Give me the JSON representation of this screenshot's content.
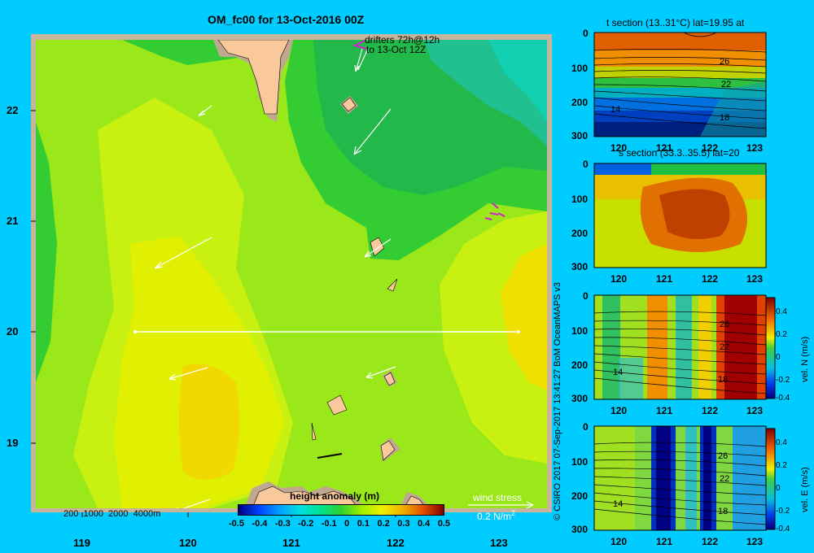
{
  "map": {
    "title": "OM_fc00 for 13-Oct-2016 00Z",
    "drifters_line1": "drifters 72h@12h",
    "drifters_line2": "to 13-Oct 12Z",
    "lat_ticks": [
      "22",
      "21",
      "20",
      "19"
    ],
    "lon_ticks": [
      "119",
      "120",
      "121",
      "122",
      "123"
    ],
    "depth_legend": "200  1000  2000  4000m",
    "colorbar_title": "height anomaly  (m)",
    "colorbar_ticks": [
      "-0.5",
      "-0.4",
      "-0.3",
      "-0.2",
      "-0.1",
      "0",
      "0.1",
      "0.2",
      "0.3",
      "0.4",
      "0.5"
    ],
    "wind_label": "wind stress",
    "wind_scale": "0.2 N/m",
    "wind_scale_sup": "2"
  },
  "credit": "© CSIRO 2017   07-Sep-2017 13:41:27 BoM OceanMAPS v3",
  "panels": [
    {
      "title": "t section (13..31°C) lat=19.95 at",
      "y_ticks": [
        "0",
        "100",
        "200",
        "300"
      ],
      "x_ticks": [
        "120",
        "121",
        "122",
        "123"
      ],
      "contour_labels": [
        "26",
        "22",
        "14",
        "18"
      ],
      "colorbar_label": "",
      "colorbar_ticks": []
    },
    {
      "title": "s section (33.3..35.5) lat=20",
      "y_ticks": [
        "0",
        "100",
        "200",
        "300"
      ],
      "x_ticks": [
        "120",
        "121",
        "122",
        "123"
      ],
      "contour_labels": [],
      "colorbar_label": "",
      "colorbar_ticks": []
    },
    {
      "title": "",
      "y_ticks": [
        "0",
        "100",
        "200",
        "300"
      ],
      "x_ticks": [
        "120",
        "121",
        "122",
        "123"
      ],
      "contour_labels": [
        "26",
        "22",
        "14",
        "18"
      ],
      "colorbar_label": "vel. N (m/s)",
      "colorbar_ticks": [
        "0.4",
        "0.2",
        "0",
        "-0.2",
        "-0.4"
      ]
    },
    {
      "title": "",
      "y_ticks": [
        "0",
        "100",
        "200",
        "300"
      ],
      "x_ticks": [
        "120",
        "121",
        "122",
        "123"
      ],
      "contour_labels": [
        "26",
        "22",
        "14",
        "18"
      ],
      "colorbar_label": "vel. E (m/s)",
      "colorbar_ticks": [
        "0.4",
        "0.2",
        "0",
        "-0.2",
        "-0.4"
      ]
    }
  ],
  "colors": {
    "background": "#00ccff",
    "land": "#f9c89b",
    "shelf": "#c0a890",
    "frame": "#c8b49a",
    "drifter": "#d020d0"
  }
}
